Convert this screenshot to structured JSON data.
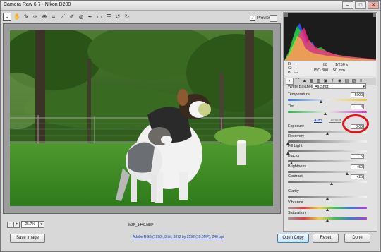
{
  "window": {
    "title": "Camera Raw 6.7  -  Nikon D200",
    "minimize": "–",
    "maximize": "□",
    "close": "✕"
  },
  "toolbar": {
    "tools": [
      "zoom-icon",
      "hand-icon",
      "white-balance-icon",
      "color-sampler-icon",
      "targeted-adjustment-icon",
      "crop-icon",
      "straighten-icon",
      "spot-removal-icon",
      "red-eye-icon",
      "adjustment-brush-icon",
      "graduated-filter-icon",
      "preferences-icon",
      "rotate-ccw-icon",
      "rotate-cw-icon"
    ],
    "preview_label": "Preview",
    "preview_checked": "✓"
  },
  "image": {
    "filename": "M2F_1448.NEF",
    "zoom": "25.7%"
  },
  "histogram": {
    "r_label": "R:",
    "g_label": "G:",
    "b_label": "B:",
    "r_value": "---",
    "g_value": "---",
    "b_value": "---",
    "aperture": "f/8",
    "shutter": "1/250 s",
    "iso": "ISO 800",
    "focal": "50 mm"
  },
  "panel": {
    "section_title": "Basic",
    "white_balance_label": "White Balance:",
    "white_balance_value": "As Shot",
    "auto_label": "Auto",
    "default_label": "Default",
    "sliders": [
      {
        "label": "Temperature",
        "value": "5000",
        "pos": 0.42,
        "gradient": "temp"
      },
      {
        "label": "Tint",
        "value": "-4",
        "pos": 0.48,
        "gradient": "tint"
      },
      {
        "label": "Exposure",
        "value": "0.00",
        "pos": 0.5,
        "gradient": "gray"
      },
      {
        "label": "Recovery",
        "value": "",
        "pos": 0.0,
        "gradient": "gray"
      },
      {
        "label": "Fill Light",
        "value": "",
        "pos": 0.0,
        "gradient": "gray"
      },
      {
        "label": "Blacks",
        "value": "5",
        "pos": 0.05,
        "gradient": "gray"
      },
      {
        "label": "Brightness",
        "value": "+50",
        "pos": 0.75,
        "gradient": "gray"
      },
      {
        "label": "Contrast",
        "value": "+25",
        "pos": 0.56,
        "gradient": "gray"
      },
      {
        "label": "Clarity",
        "value": "",
        "pos": 0.5,
        "gradient": "gray"
      },
      {
        "label": "Vibrance",
        "value": "",
        "pos": 0.5,
        "gradient": "sat"
      },
      {
        "label": "Saturation",
        "value": "",
        "pos": 0.5,
        "gradient": "sat"
      }
    ]
  },
  "buttons": {
    "save": "Save Image",
    "open": "Open Copy",
    "reset": "Reset",
    "done": "Done"
  },
  "workflow": "Adobe RGB (1998); 8 bit; 3872 by 2592 (10.0MP); 240 ppi",
  "colors": {
    "highlight_circle": "#e0141b",
    "link": "#1a3fb0"
  }
}
